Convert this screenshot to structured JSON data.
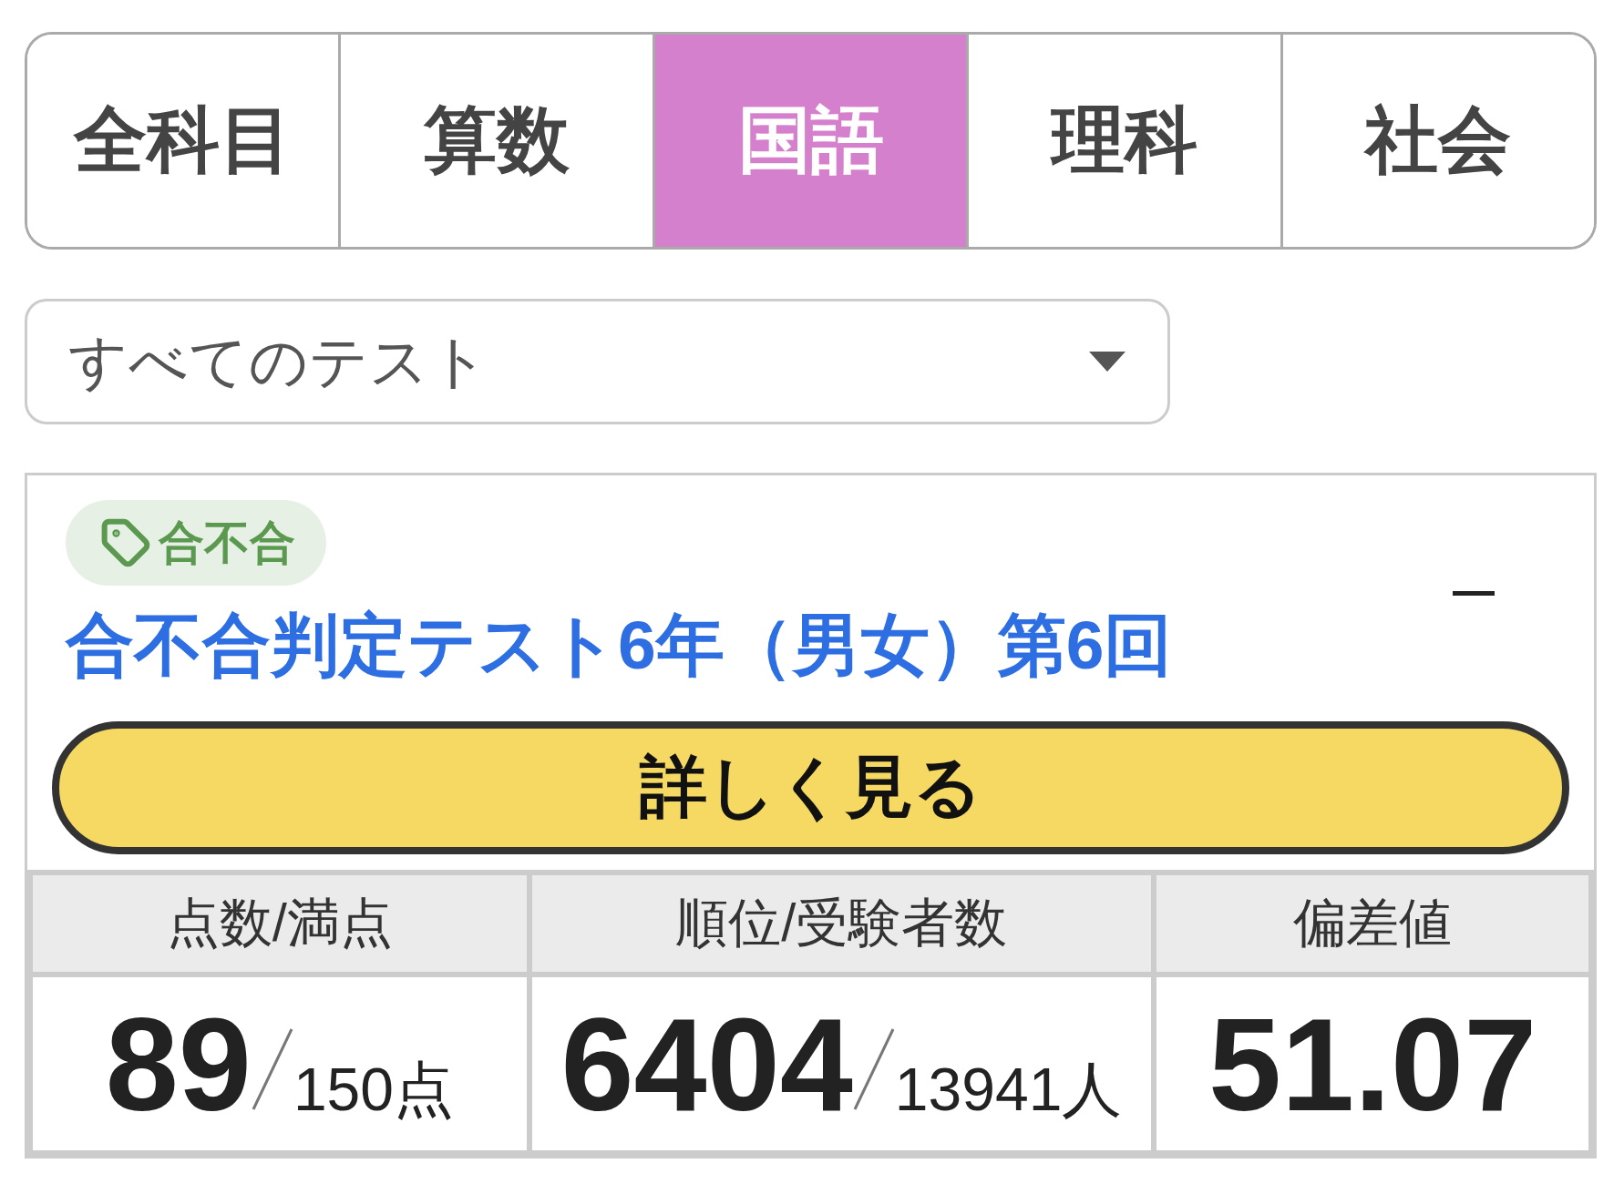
{
  "subject_tabs": [
    {
      "label": "全科目",
      "selected": false
    },
    {
      "label": "算数",
      "selected": false
    },
    {
      "label": "国語",
      "selected": true
    },
    {
      "label": "理科",
      "selected": false
    },
    {
      "label": "社会",
      "selected": false
    }
  ],
  "test_filter": {
    "value": "すべてのテスト"
  },
  "result_card": {
    "tag": "合不合",
    "expanded": true,
    "title": "合不合判定テスト6年（男女）第6回",
    "details_button": "詳しく見る",
    "stats": {
      "columns": [
        "点数/満点",
        "順位/受験者数",
        "偏差値"
      ],
      "cells": [
        {
          "value": "89",
          "total": "150点"
        },
        {
          "value": "6404",
          "total": "13941人"
        },
        {
          "value": "51.07"
        }
      ]
    }
  }
}
